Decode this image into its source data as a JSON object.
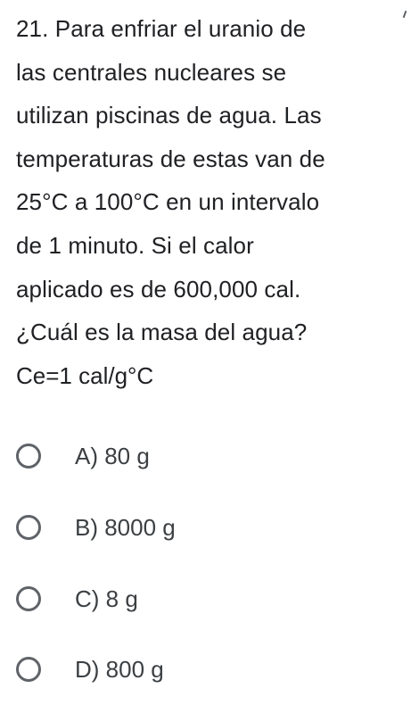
{
  "question": {
    "lines": [
      "21. Para enfriar el uranio de",
      "las centrales nucleares se",
      "utilizan piscinas de agua. Las",
      "temperaturas de estas van de",
      "25°C a 100°C en un intervalo",
      "de 1 minuto. Si el calor",
      "aplicado es de 600,000 cal.",
      "¿Cuál es la masa del agua?"
    ],
    "formula": "Ce=1 cal/g°C"
  },
  "options": [
    {
      "label": "A) 80 g",
      "selected": false
    },
    {
      "label": "B) 8000 g",
      "selected": false
    },
    {
      "label": "C) 8 g",
      "selected": false
    },
    {
      "label": "D) 800 g",
      "selected": false
    }
  ],
  "colors": {
    "text": "#202124",
    "option_text": "#3c4043",
    "radio_border": "#5f6368",
    "background": "#ffffff"
  }
}
